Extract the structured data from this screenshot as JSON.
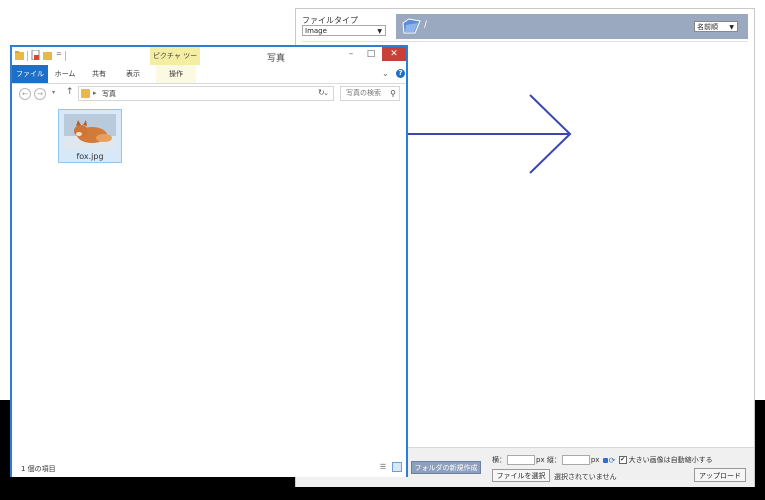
{
  "back_window": {
    "filetype_label": "ファイルタイプ",
    "filetype_value": "Image",
    "path": "/",
    "sort_value": "名前順",
    "footer": {
      "new_folder": "フォルダの新規作成",
      "width_label": "横：",
      "height_label": "縦：",
      "unit_px": "px",
      "auto_shrink_label": "大きい画像は自動縮小する",
      "choose_file": "ファイルを選択",
      "no_file": "選択されていません",
      "upload": "アップロード"
    }
  },
  "explorer": {
    "context_tab": "ピクチャ ツール",
    "title": "写真",
    "tabs": {
      "file": "ファイル",
      "home": "ホーム",
      "share": "共有",
      "view": "表示",
      "manage": "操作"
    },
    "address": "写真",
    "search_placeholder": "写真の検索",
    "files": [
      {
        "name": "fox.jpg"
      }
    ],
    "status": "1 個の項目"
  },
  "colors": {
    "explorer_border": "#2c7fd4",
    "arrow": "#3b46b4",
    "pathbar": "#9aa9c0",
    "close_button": "#c7413a"
  }
}
